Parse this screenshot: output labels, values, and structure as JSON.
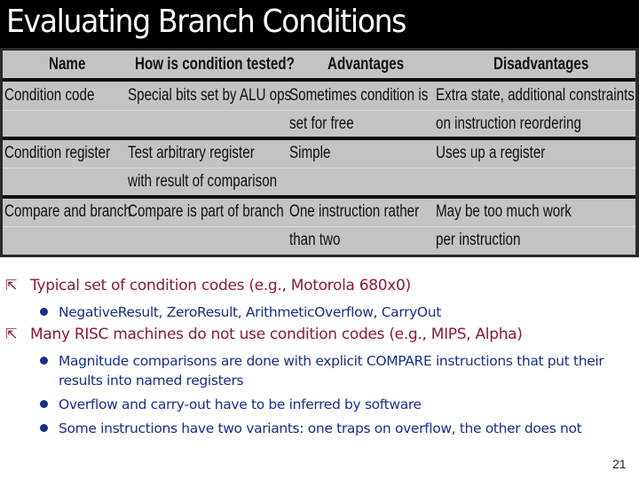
{
  "slide": {
    "title": "Evaluating Branch Conditions",
    "page_number": "21"
  },
  "table": {
    "headers": [
      "Name",
      "How is condition tested?",
      "Advantages",
      "Disadvantages"
    ],
    "rows": [
      {
        "lines": [
          [
            "Condition code",
            "Special bits set by ALU ops",
            "Sometimes condition is",
            "Extra state,  additional constraints"
          ],
          [
            "",
            "",
            "set for free",
            "on instruction reordering"
          ]
        ]
      },
      {
        "lines": [
          [
            "Condition register",
            "Test arbitrary register",
            "Simple",
            "Uses up a register"
          ],
          [
            "",
            "with result of comparison",
            "",
            ""
          ]
        ]
      },
      {
        "lines": [
          [
            "Compare and branch",
            "Compare is part of branch",
            "One instruction rather",
            "May be too much work"
          ],
          [
            "",
            "",
            "than two",
            "per instruction"
          ]
        ]
      }
    ]
  },
  "bullets": [
    {
      "icon": "arrow-bullet-icon",
      "text": "Typical set of condition codes (e.g., Motorola 680x0)",
      "sub": [
        "NegativeResult, ZeroResult, ArithmeticOverflow, CarryOut"
      ]
    },
    {
      "icon": "arrow-bullet-icon",
      "text": "Many RISC machines do not use condition codes (e.g., MIPS, Alpha)",
      "sub": [
        "Magnitude comparisons are done with explicit COMPARE instructions that put their results into named registers",
        "Overflow and carry-out have to be inferred by software",
        "Some instructions have two variants: one traps on overflow, the other does not"
      ]
    }
  ],
  "colors": {
    "title_bg": "#000000",
    "title_fg": "#ffffff",
    "table_bg": "#c3c3c3",
    "level1_text": "#8b1a3a",
    "level2_text": "#1a2f8a"
  }
}
